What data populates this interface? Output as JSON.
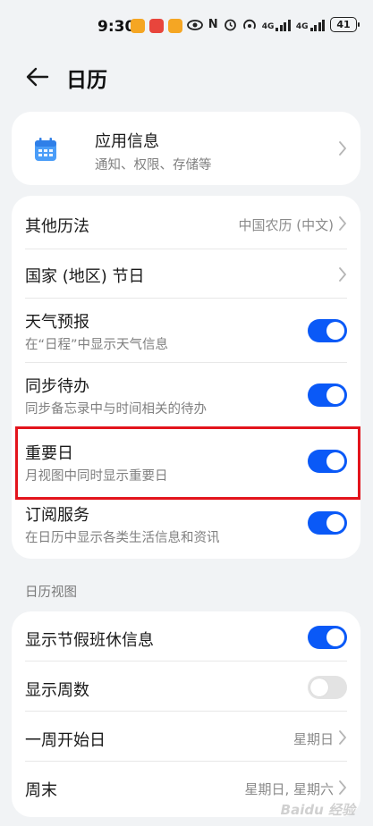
{
  "status_bar": {
    "time": "9:30",
    "network_label": "4G",
    "network_label_2": "4G",
    "battery": "41",
    "nfc": "N"
  },
  "header": {
    "title": "日历"
  },
  "app_info": {
    "title": "应用信息",
    "subtitle": "通知、权限、存储等"
  },
  "settings": {
    "other_calendar": {
      "label": "其他历法",
      "value": "中国农历 (中文)"
    },
    "holidays": {
      "label": "国家 (地区) 节日"
    },
    "weather": {
      "label": "天气预报",
      "sub": "在“日程”中显示天气信息",
      "on": true
    },
    "sync_todo": {
      "label": "同步待办",
      "sub": "同步备忘录中与时间相关的待办",
      "on": true
    },
    "important_days": {
      "label": "重要日",
      "sub": "月视图中同时显示重要日",
      "on": true
    },
    "subscription": {
      "label": "订阅服务",
      "sub": "在日历中显示各类生活信息和资讯",
      "on": true
    }
  },
  "view_section": {
    "label": "日历视图",
    "holiday_info": {
      "label": "显示节假班休信息",
      "on": true
    },
    "week_numbers": {
      "label": "显示周数",
      "on": false
    },
    "week_start": {
      "label": "一周开始日",
      "value": "星期日"
    },
    "weekend": {
      "label": "周末",
      "value": "星期日, 星期六"
    }
  },
  "watermark": "Baidu 经验",
  "colors": {
    "accent": "#0a59f7",
    "highlight": "#e3141c",
    "background": "#f1f3f5"
  }
}
